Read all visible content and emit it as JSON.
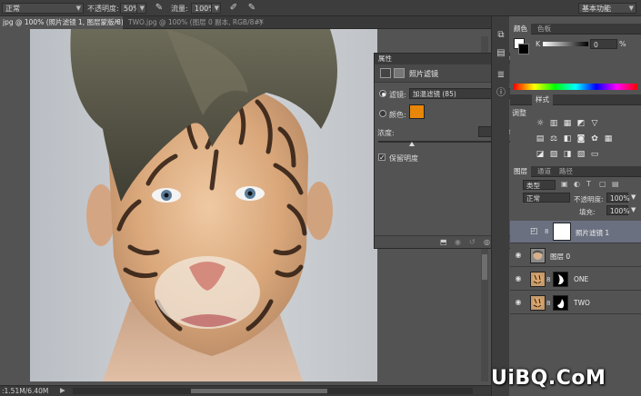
{
  "options_bar": {
    "mode": "正常",
    "opacity_label": "不透明度:",
    "opacity_value": "50%",
    "flow_label": "流量:",
    "flow_value": "100%",
    "workspace": "基本功能"
  },
  "doc_tabs": [
    {
      "label": "jpg @ 100% (照片滤镜 1, 图层蒙版/8) *"
    },
    {
      "label": "TWO.jpg @ 100% (图层 0 副本, RGB/8#) *"
    }
  ],
  "status": {
    "doc_size": ":1.51M/6.40M"
  },
  "properties": {
    "title": "属性",
    "subtitle": "照片滤镜",
    "filter_label": "滤镜:",
    "filter_value": "加温滤镜 (85)",
    "color_label": "颜色:",
    "filter_color": "#e8860a",
    "density_label": "浓度:",
    "density_value": "25",
    "density_unit": "%",
    "density_level": 0.25,
    "preserve_label": "保留明度",
    "preserve_checked": "✓"
  },
  "color_panel": {
    "tabs": [
      "颜色",
      "色板"
    ],
    "k_label": "K",
    "k_value": "0",
    "k_unit": "%"
  },
  "styles_panel": {
    "tabs": [
      "样式"
    ],
    "adjust_title": "调整"
  },
  "layers_panel": {
    "tabs": [
      "图层",
      "通道",
      "路径"
    ],
    "kind_label": "类型",
    "blend_mode": "正常",
    "opacity_label": "不透明度:",
    "opacity_value": "100%",
    "fill_label": "填充:",
    "fill_value": "100%",
    "layers": [
      {
        "name": "照片滤镜 1",
        "selected": true
      },
      {
        "name": "图层 0",
        "selected": false
      },
      {
        "name": "ONE",
        "selected": false
      },
      {
        "name": "TWO",
        "selected": false
      }
    ]
  },
  "watermark": "UiBQ.CoM",
  "colors": {
    "ui_dark": "#3d3d3d",
    "ui_mid": "#535353",
    "selected_row": "#6a7080",
    "filter_orange": "#e8860a"
  }
}
